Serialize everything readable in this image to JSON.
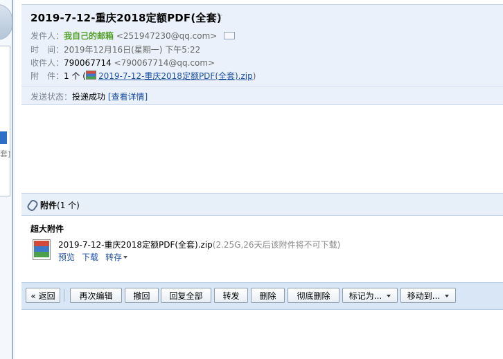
{
  "email": {
    "subject": "2019-7-12-重庆2018定额PDF(全套)",
    "from_label": "发件人：",
    "from_name": "我自己的邮箱",
    "from_addr": "<251947230@qq.com>",
    "time_label": "时　间：",
    "time_value": "2019年12月16日(星期一) 下午5:22",
    "to_label": "收件人：",
    "to_name": "790067714",
    "to_addr": "<790067714@qq.com>",
    "att_label": "附　件：",
    "att_count": "1 个 (",
    "att_link": "2019-7-12-重庆2018定额PDF(全套).zip",
    "att_close": ")",
    "status_label": "发送状态：",
    "status_value": "投递成功",
    "status_detail": "[查看详情]"
  },
  "attachments": {
    "title": "附件",
    "count": "(1 个)",
    "section_label": "超大附件",
    "file_name": "2019-7-12-重庆2018定额PDF(全套).zip",
    "file_note": "(2.25G,26天后该附件将不可下载)",
    "actions": {
      "preview": "预览",
      "download": "下载",
      "save": "转存"
    }
  },
  "toolbar": {
    "back": "« 返回",
    "reedit": "再次编辑",
    "recall": "撤回",
    "reply_all": "回复全部",
    "forward": "转发",
    "delete": "删除",
    "delete_perm": "彻底删除",
    "mark_as": "标记为...",
    "move_to": "移动到..."
  },
  "sidebar": {
    "bracket": "套]"
  },
  "icons": {
    "star": "star-icon",
    "contact_card": "contact-card-icon",
    "paperclip": "paperclip-icon",
    "zip_file": "zip-file-icon",
    "dropdown": "chevron-down-icon"
  },
  "colors": {
    "header_bg": "#eaf1fa",
    "sender_green": "#55a02b",
    "link_blue": "#1e50a2",
    "toolbar_bg": "#d9e6f5"
  }
}
